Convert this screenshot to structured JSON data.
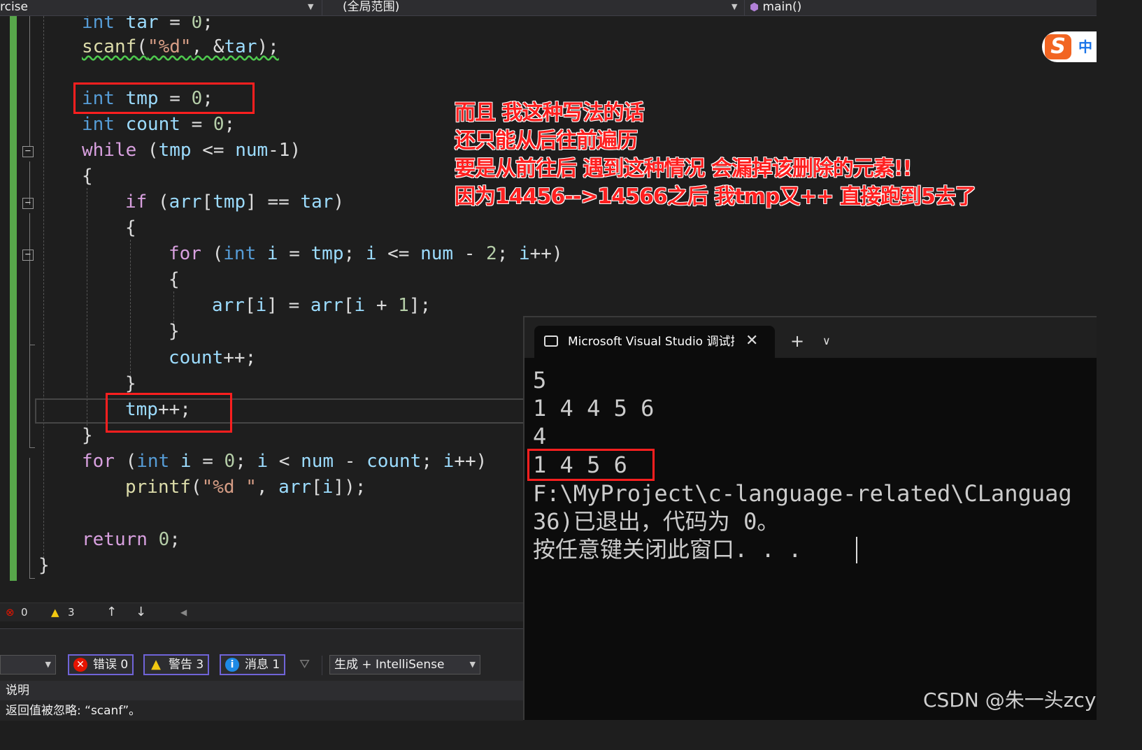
{
  "navbar": {
    "project_combo": "rcise",
    "scope_combo": "(全局范围)",
    "member_combo": "main()"
  },
  "code": {
    "line1": [
      "int",
      "tar",
      "=",
      "0",
      ";"
    ],
    "line2": {
      "fn": "scanf",
      "open": "(",
      "fmt": "\"%d\"",
      "rest": ", &",
      "var": "tar",
      "close": ");"
    },
    "line3": [
      "int",
      "tmp",
      "=",
      "0",
      ";"
    ],
    "line4": [
      "int",
      "count",
      "=",
      "0",
      ";"
    ],
    "line5": {
      "kw": "while",
      "a": " (",
      "v1": "tmp",
      "b": " <= ",
      "v2": "num",
      "c": "-1)"
    },
    "line6": "{",
    "line7": {
      "kw": "if",
      "a": " (",
      "v1": "arr",
      "b": "[",
      "v2": "tmp",
      "c": "] == ",
      "v3": "tar",
      "d": ")"
    },
    "line8": "{",
    "line9": {
      "kw": "for",
      "a": " (",
      "t": "int",
      "v1": " i",
      "b": " = ",
      "v2": "tmp",
      "c": "; ",
      "v3": "i",
      "d": " <= ",
      "v4": "num",
      "e": " - ",
      "n": "2",
      "f": "; ",
      "v5": "i",
      "g": "++)"
    },
    "line10": "{",
    "line11": {
      "v1": "arr",
      "a": "[",
      "v2": "i",
      "b": "] = ",
      "v3": "arr",
      "c": "[",
      "v4": "i",
      "d": " + ",
      "n": "1",
      "e": "];"
    },
    "line12": "}",
    "line13": {
      "v": "count",
      "a": "++;"
    },
    "line14": "}",
    "line15": {
      "v": "tmp",
      "a": "++;"
    },
    "line16": "}",
    "line17": {
      "kw": "for",
      "a": " (",
      "t": "int",
      "v1": " i",
      "b": " = ",
      "n": "0",
      "c": "; ",
      "v2": "i",
      "d": " < ",
      "v3": "num",
      "e": " - ",
      "v4": "count",
      "f": "; ",
      "v5": "i",
      "g": "++)"
    },
    "line18": {
      "fn": "printf",
      "a": "(",
      "fmt": "\"%d \"",
      "b": ", ",
      "v1": "arr",
      "c": "[",
      "v2": "i",
      "d": "]);"
    },
    "line19": {
      "kw": "return",
      "a": " ",
      "n": "0",
      "b": ";"
    },
    "line20": "}"
  },
  "annotation": {
    "line1": "而且 我这种写法的话",
    "line2": "还只能从后往前遍历",
    "line3": "要是从前往后 遇到这种情况 会漏掉该删除的元素!!",
    "line4": "因为14456-->14566之后 我tmp又++ 直接跑到5去了"
  },
  "ime": {
    "logo": "S",
    "label": "中"
  },
  "status": {
    "errors": "0",
    "warnings": "3"
  },
  "error_list": {
    "errors_btn": "错误 0",
    "warnings_btn": "警告 3",
    "messages_btn": "消息 1",
    "source_combo": "生成 + IntelliSense",
    "column_header": "说明",
    "row_text": "返回值被忽略: “scanf”。"
  },
  "console": {
    "tab_title": "Microsoft Visual Studio 调试控制台",
    "output": [
      "5",
      "1 4 4 5 6",
      "4",
      "1 4 5 6",
      "F:\\MyProject\\c-language-related\\CLanguag",
      "36)已退出，代码为 0。",
      "按任意键关闭此窗口. . ."
    ]
  },
  "watermark": "CSDN @朱一头zcy",
  "colors": {
    "accent_red": "#ff1f1f",
    "change_bar": "#57a64a",
    "filter_border": "#7064d8"
  }
}
